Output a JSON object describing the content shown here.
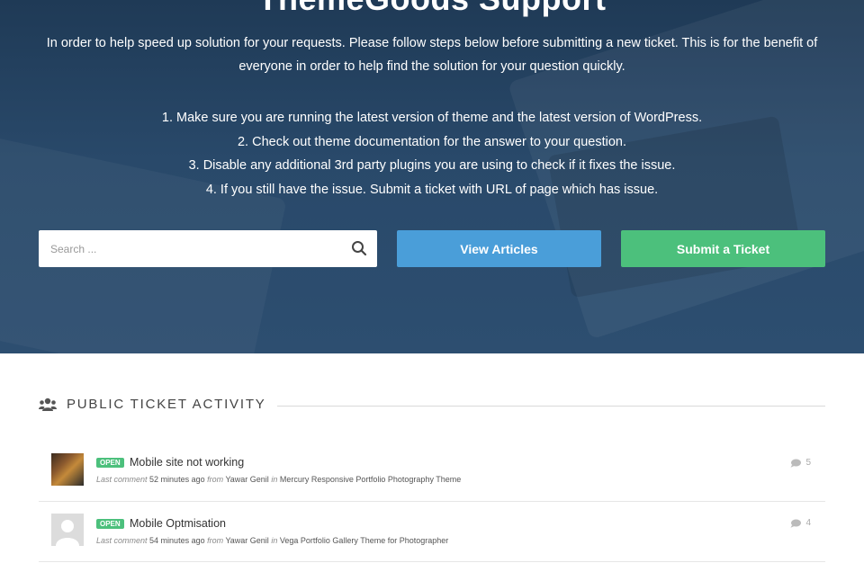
{
  "hero": {
    "title": "ThemeGoods Support",
    "intro": "In order to help speed up solution for your requests. Please follow steps below before submitting a new ticket. This is for the benefit of everyone in order to help find the solution for your question quickly.",
    "steps": [
      "1. Make sure you are running the latest version of theme and the latest version of WordPress.",
      "2. Check out theme documentation for the answer to your question.",
      "3. Disable any additional 3rd party plugins you are using to check if it fixes the issue.",
      "4. If you still have the issue. Submit a ticket with URL of page which has issue."
    ]
  },
  "search": {
    "placeholder": "Search ...",
    "value": ""
  },
  "buttons": {
    "view_articles": "View Articles",
    "submit_ticket": "Submit a Ticket"
  },
  "colors": {
    "view_button": "#4a9ed9",
    "submit_button": "#4cc07c",
    "open_badge": "#4cc07c",
    "hero_bg": "#29496a"
  },
  "activity": {
    "heading": "PUBLIC TICKET ACTIVITY",
    "icon": "users-icon",
    "tickets": [
      {
        "status": "OPEN",
        "title": "Mobile site not working",
        "last_comment_label": "Last comment",
        "time": "52 minutes ago",
        "from_label": "from",
        "author": "Yawar Genil",
        "in_label": "in",
        "theme": "Mercury Responsive Portfolio Photography Theme",
        "comments": "5"
      },
      {
        "status": "OPEN",
        "title": "Mobile Optmisation",
        "last_comment_label": "Last comment",
        "time": "54 minutes ago",
        "from_label": "from",
        "author": "Yawar Genil",
        "in_label": "in",
        "theme": "Vega Portfolio Gallery Theme for Photographer",
        "comments": "4"
      }
    ]
  }
}
